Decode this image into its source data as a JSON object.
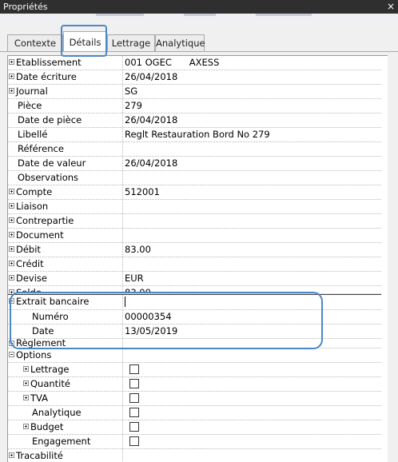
{
  "window": {
    "title": "Propriétés",
    "close": "×"
  },
  "tabs": [
    {
      "label": "Contexte"
    },
    {
      "label": "Détails",
      "active": true
    },
    {
      "label": "Lettrage"
    },
    {
      "label": "Analytique"
    }
  ],
  "rows": {
    "etablissement": {
      "label": "Etablissement",
      "value": "001 OGEC      AXESS"
    },
    "date_ecriture": {
      "label": "Date écriture",
      "value": "26/04/2018"
    },
    "journal": {
      "label": "Journal",
      "value": "SG"
    },
    "piece": {
      "label": "Pièce",
      "value": "279"
    },
    "date_piece": {
      "label": "Date de pièce",
      "value": "26/04/2018"
    },
    "libelle": {
      "label": "Libellé",
      "value": "Reglt Restauration Bord No 279"
    },
    "reference": {
      "label": "Référence",
      "value": ""
    },
    "date_valeur": {
      "label": "Date de valeur",
      "value": "26/04/2018"
    },
    "observations": {
      "label": "Observations",
      "value": ""
    },
    "compte": {
      "label": "Compte",
      "value": "512001"
    },
    "liaison": {
      "label": "Liaison",
      "value": ""
    },
    "contrepartie": {
      "label": "Contrepartie",
      "value": ""
    },
    "document": {
      "label": "Document",
      "value": ""
    },
    "debit": {
      "label": "Débit",
      "value": "83.00"
    },
    "credit": {
      "label": "Crédit",
      "value": ""
    },
    "devise": {
      "label": "Devise",
      "value": "EUR"
    },
    "solde": {
      "label": "Solde",
      "value": "83.00"
    },
    "extrait_bancaire": {
      "label": "Extrait bancaire",
      "value": ""
    },
    "numero": {
      "label": "Numéro",
      "value": "00000354"
    },
    "date": {
      "label": "Date",
      "value": "13/05/2019"
    },
    "reglement": {
      "label": "Règlement",
      "value": ""
    },
    "options": {
      "label": "Options",
      "value": ""
    },
    "lettrage": {
      "label": "Lettrage",
      "checked": false
    },
    "quantite": {
      "label": "Quantité",
      "checked": false
    },
    "tva": {
      "label": "TVA",
      "checked": false
    },
    "analytique": {
      "label": "Analytique",
      "checked": false
    },
    "budget": {
      "label": "Budget",
      "checked": false
    },
    "engagement": {
      "label": "Engagement",
      "checked": false
    },
    "tracabilite": {
      "label": "Tracabilité",
      "value": ""
    }
  },
  "scrollbar": {
    "up_arrow": "^",
    "down_arrow": "v"
  },
  "colors": {
    "titlebar": "#2f2f2f",
    "annotation": "#4a87c8"
  }
}
